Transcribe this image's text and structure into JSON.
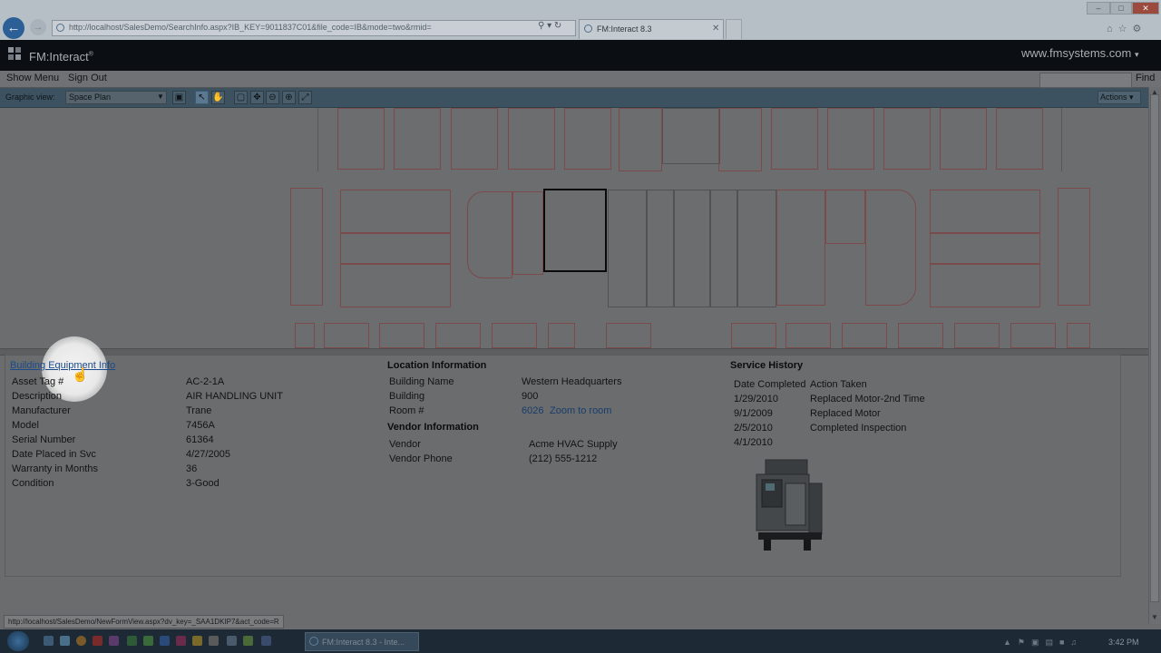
{
  "browser": {
    "url": "http://localhost/SalesDemo/SearchInfo.aspx?IB_KEY=9011837C01&file_code=IB&mode=two&rmid=",
    "tab_title": "FM:Interact 8.3",
    "back_icon": "back-arrow-icon",
    "forward_icon": "forward-arrow-icon"
  },
  "app": {
    "title": "FM:Interact",
    "title_mark": "®",
    "site_link": "www.fmsystems.com",
    "site_link_arrow": "▾"
  },
  "menu": {
    "show_menu": "Show Menu",
    "sign_out": "Sign Out",
    "find": "Find",
    "find_value": ""
  },
  "toolbar": {
    "graphic_view_label": "Graphic view:",
    "graphic_view_value": "Space Plan",
    "actions": "Actions"
  },
  "section_link": "Building Equipment Info",
  "equipment": {
    "rows": [
      {
        "label": "Asset Tag #",
        "value": "AC-2-1A"
      },
      {
        "label": "Description",
        "value": "AIR HANDLING UNIT"
      },
      {
        "label": "Manufacturer",
        "value": "Trane"
      },
      {
        "label": "Model",
        "value": "7456A"
      },
      {
        "label": "Serial Number",
        "value": "61364"
      },
      {
        "label": "Date Placed in Svc",
        "value": "4/27/2005"
      },
      {
        "label": "Warranty in Months",
        "value": "36"
      },
      {
        "label": "Condition",
        "value": "3-Good"
      }
    ]
  },
  "location": {
    "header": "Location Information",
    "building_name_label": "Building Name",
    "building_name": "Western Headquarters",
    "building_label": "Building",
    "building": "900",
    "room_label": "Room #",
    "room": "6026",
    "zoom_link": "Zoom to room"
  },
  "vendor": {
    "header": "Vendor Information",
    "vendor_label": "Vendor",
    "vendor": "Acme HVAC Supply",
    "phone_label": "Vendor Phone",
    "phone": "(212) 555-1212"
  },
  "service": {
    "header": "Service History",
    "col_date": "Date Completed",
    "col_action": "Action Taken",
    "rows": [
      {
        "date": "1/29/2010",
        "action": "Replaced Motor-2nd Time"
      },
      {
        "date": "9/1/2009",
        "action": "Replaced Motor"
      },
      {
        "date": "2/5/2010",
        "action": "Completed Inspection"
      },
      {
        "date": "4/1/2010",
        "action": ""
      }
    ]
  },
  "status_url": "http://localhost/SalesDemo/NewFormView.aspx?dv_key=_SAA1DKIP7&act_code=R",
  "taskbar": {
    "task_label": "FM:Interact 8.3 - Inte...",
    "clock": "3:42 PM"
  }
}
